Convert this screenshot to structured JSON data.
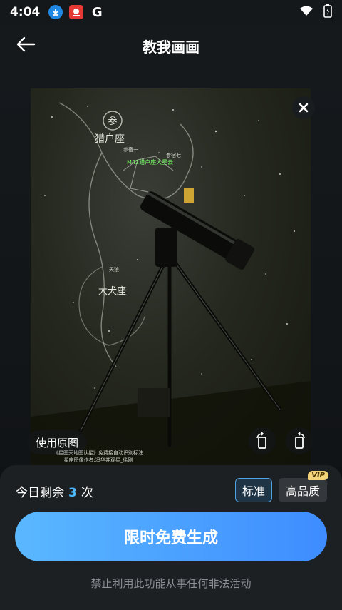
{
  "status_bar": {
    "time": "4:04",
    "icons": [
      "download-icon",
      "app-notification-icon",
      "google-icon",
      "wifi-icon",
      "battery-charging-icon"
    ],
    "google_letter": "G"
  },
  "header": {
    "title": "教我画画",
    "back_icon": "arrow-left-icon"
  },
  "image_panel": {
    "close_icon": "close-icon",
    "use_original_label": "使用原图",
    "rotate_left_icon": "rotate-left-icon",
    "rotate_right_icon": "rotate-right-icon",
    "photo_labels": {
      "constellation_1": "猎户座",
      "constellation_2": "大犬座",
      "badge": "参",
      "highlight": "M42猎户座大星云",
      "star_1": "参宿一",
      "star_2": "参宿七",
      "star_3": "天狼"
    },
    "caption_lines": [
      "《星图天地图认星》免费接自动识别标注",
      "星座图像作者:冯华并观星_徐刚"
    ]
  },
  "bottom_sheet": {
    "remaining_prefix": "今日剩余",
    "remaining_count": "3",
    "remaining_suffix": "次",
    "quality_standard_label": "标准",
    "quality_high_label": "高品质",
    "vip_badge": "VIP",
    "generate_button_label": "限时免费生成",
    "disclaimer": "禁止利用此功能从事任何非法活动"
  },
  "colors": {
    "accent_blue": "#4fb7ff",
    "button_gradient_start": "#5ab8ff",
    "button_gradient_end": "#3e8cff",
    "vip_gold": "#f3d37a",
    "background": "#0f1214"
  }
}
